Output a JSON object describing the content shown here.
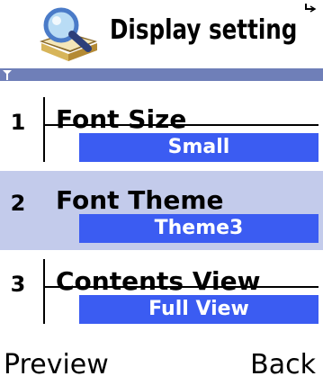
{
  "header": {
    "title": "Display setting"
  },
  "settings": {
    "items": [
      {
        "number": "1",
        "label": "Font Size",
        "value": "Small",
        "selected": false
      },
      {
        "number": "2",
        "label": "Font Theme",
        "value": "Theme3",
        "selected": true
      },
      {
        "number": "3",
        "label": "Contents View",
        "value": "Full View",
        "selected": false
      }
    ]
  },
  "softkeys": {
    "left": "Preview",
    "right": "Back"
  },
  "colors": {
    "selected_row": "#c3cbeb",
    "value_box": "#3b5cf2",
    "signal_bar": "#6f7fb8"
  }
}
